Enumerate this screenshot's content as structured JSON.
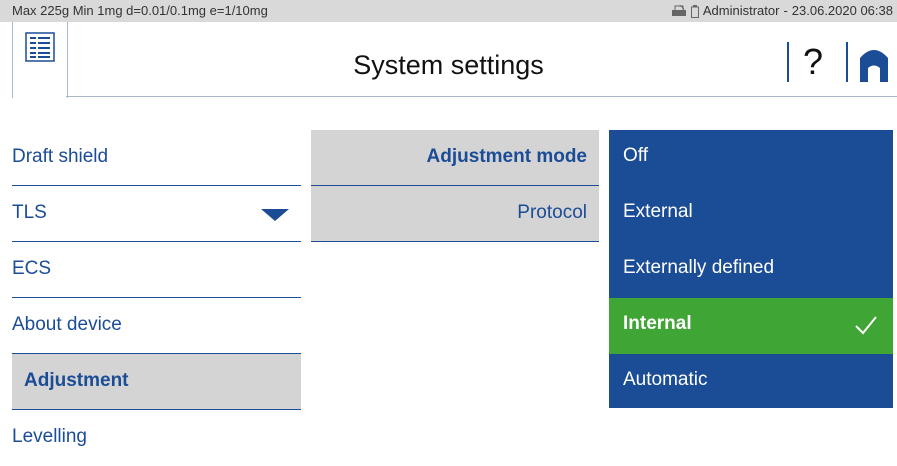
{
  "status_bar": {
    "scale_info": "Max 225g  Min 1mg  d=0.01/0.1mg  e=1/10mg",
    "user": "Administrator",
    "separator": "-",
    "datetime": "23.06.2020 06:38",
    "icons": [
      "printer-icon",
      "battery-icon"
    ]
  },
  "header": {
    "title": "System settings",
    "help_label": "?",
    "icons": [
      "menu-list-icon",
      "help-icon",
      "home-icon"
    ]
  },
  "left_menu": {
    "items": [
      {
        "label": "Draft shield"
      },
      {
        "label": "TLS"
      },
      {
        "label": "ECS"
      },
      {
        "label": "About device"
      },
      {
        "label": "Adjustment",
        "active": true
      },
      {
        "label": "Levelling"
      }
    ]
  },
  "middle_menu": {
    "items": [
      {
        "label": "Adjustment mode",
        "active": true
      },
      {
        "label": "Protocol"
      }
    ]
  },
  "options": {
    "items": [
      {
        "label": "Off"
      },
      {
        "label": "External"
      },
      {
        "label": "Externally defined"
      },
      {
        "label": "Internal",
        "selected": true
      },
      {
        "label": "Automatic"
      }
    ]
  },
  "colors": {
    "brand_blue": "#1b4c96",
    "selected_green": "#3fa535",
    "status_bar_bg": "#d9d9d9",
    "active_item_bg": "#d4d4d4"
  }
}
